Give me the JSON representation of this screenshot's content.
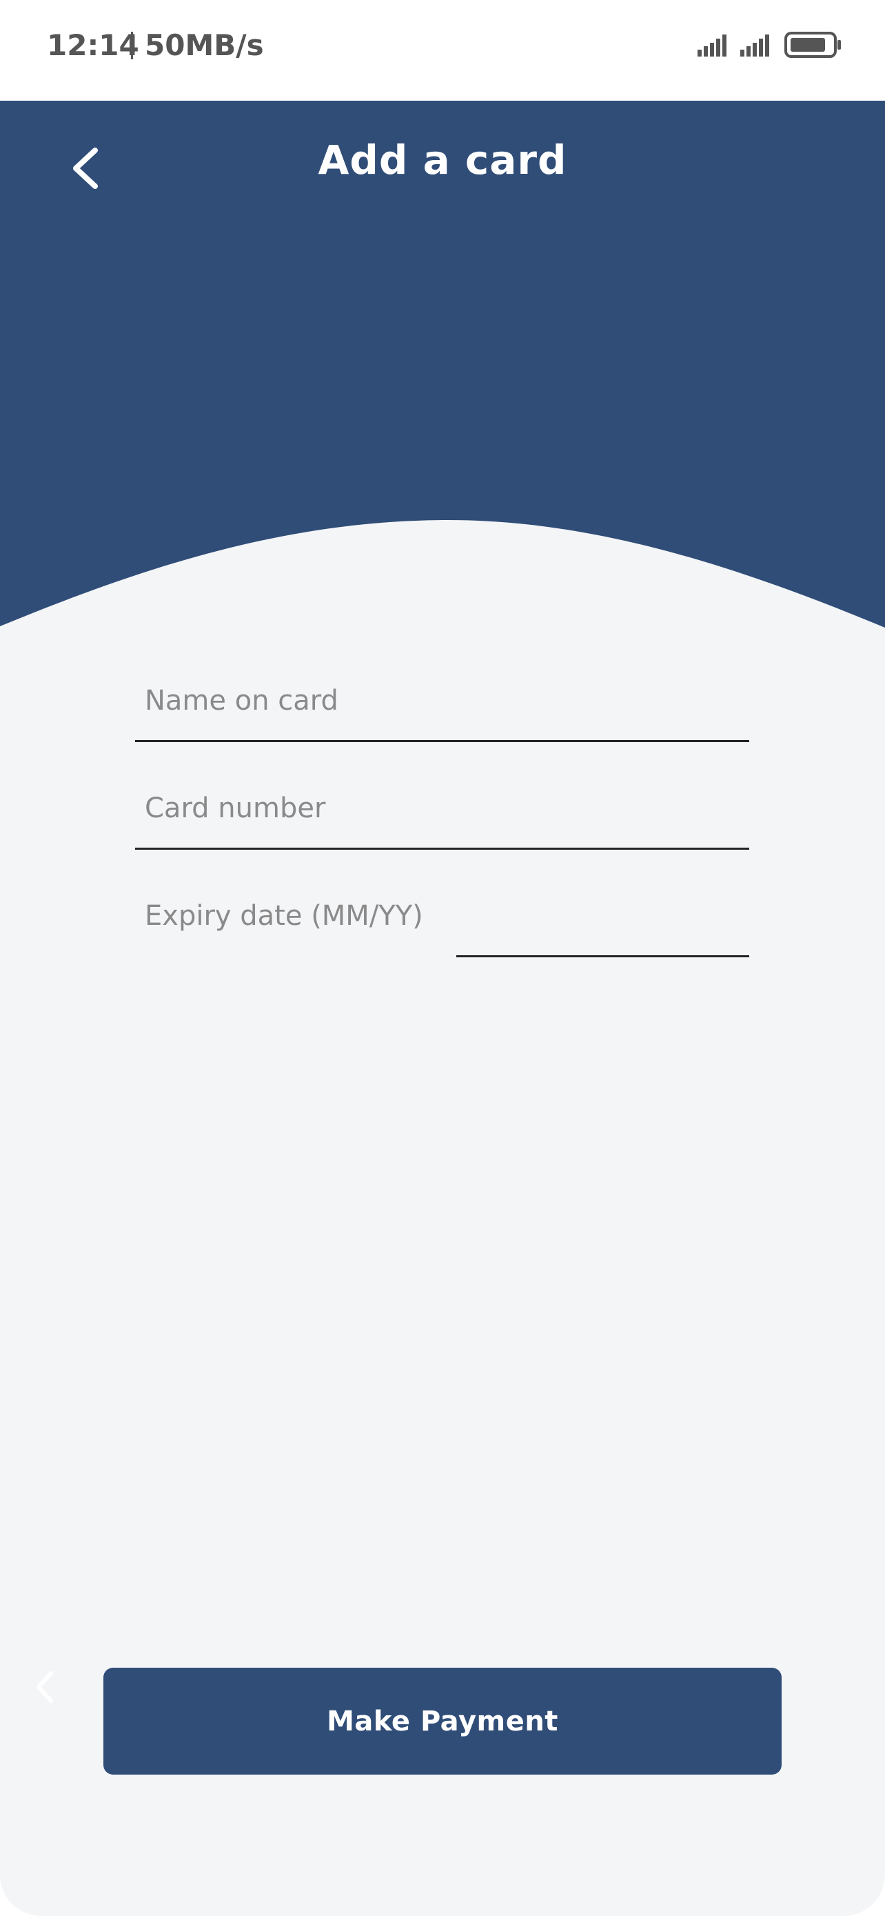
{
  "status_bar": {
    "time": "12:14",
    "network_speed": "50MB/s",
    "icons": [
      "signal-icon",
      "signal-icon",
      "battery-icon"
    ]
  },
  "header": {
    "title": "Add a card",
    "back_icon": "chevron-left-icon",
    "background_color": "#304d78"
  },
  "form": {
    "name_on_card": {
      "placeholder": "Name on card",
      "value": ""
    },
    "card_number": {
      "placeholder": "Card number",
      "value": ""
    },
    "expiry_date": {
      "label": "Expiry date (MM/YY)",
      "value": ""
    }
  },
  "footer": {
    "make_payment_label": "Make Payment",
    "button_color": "#304d78"
  },
  "colors": {
    "page_background": "#f4f5f7",
    "accent": "#304d78",
    "placeholder": "#8a8a8a"
  }
}
